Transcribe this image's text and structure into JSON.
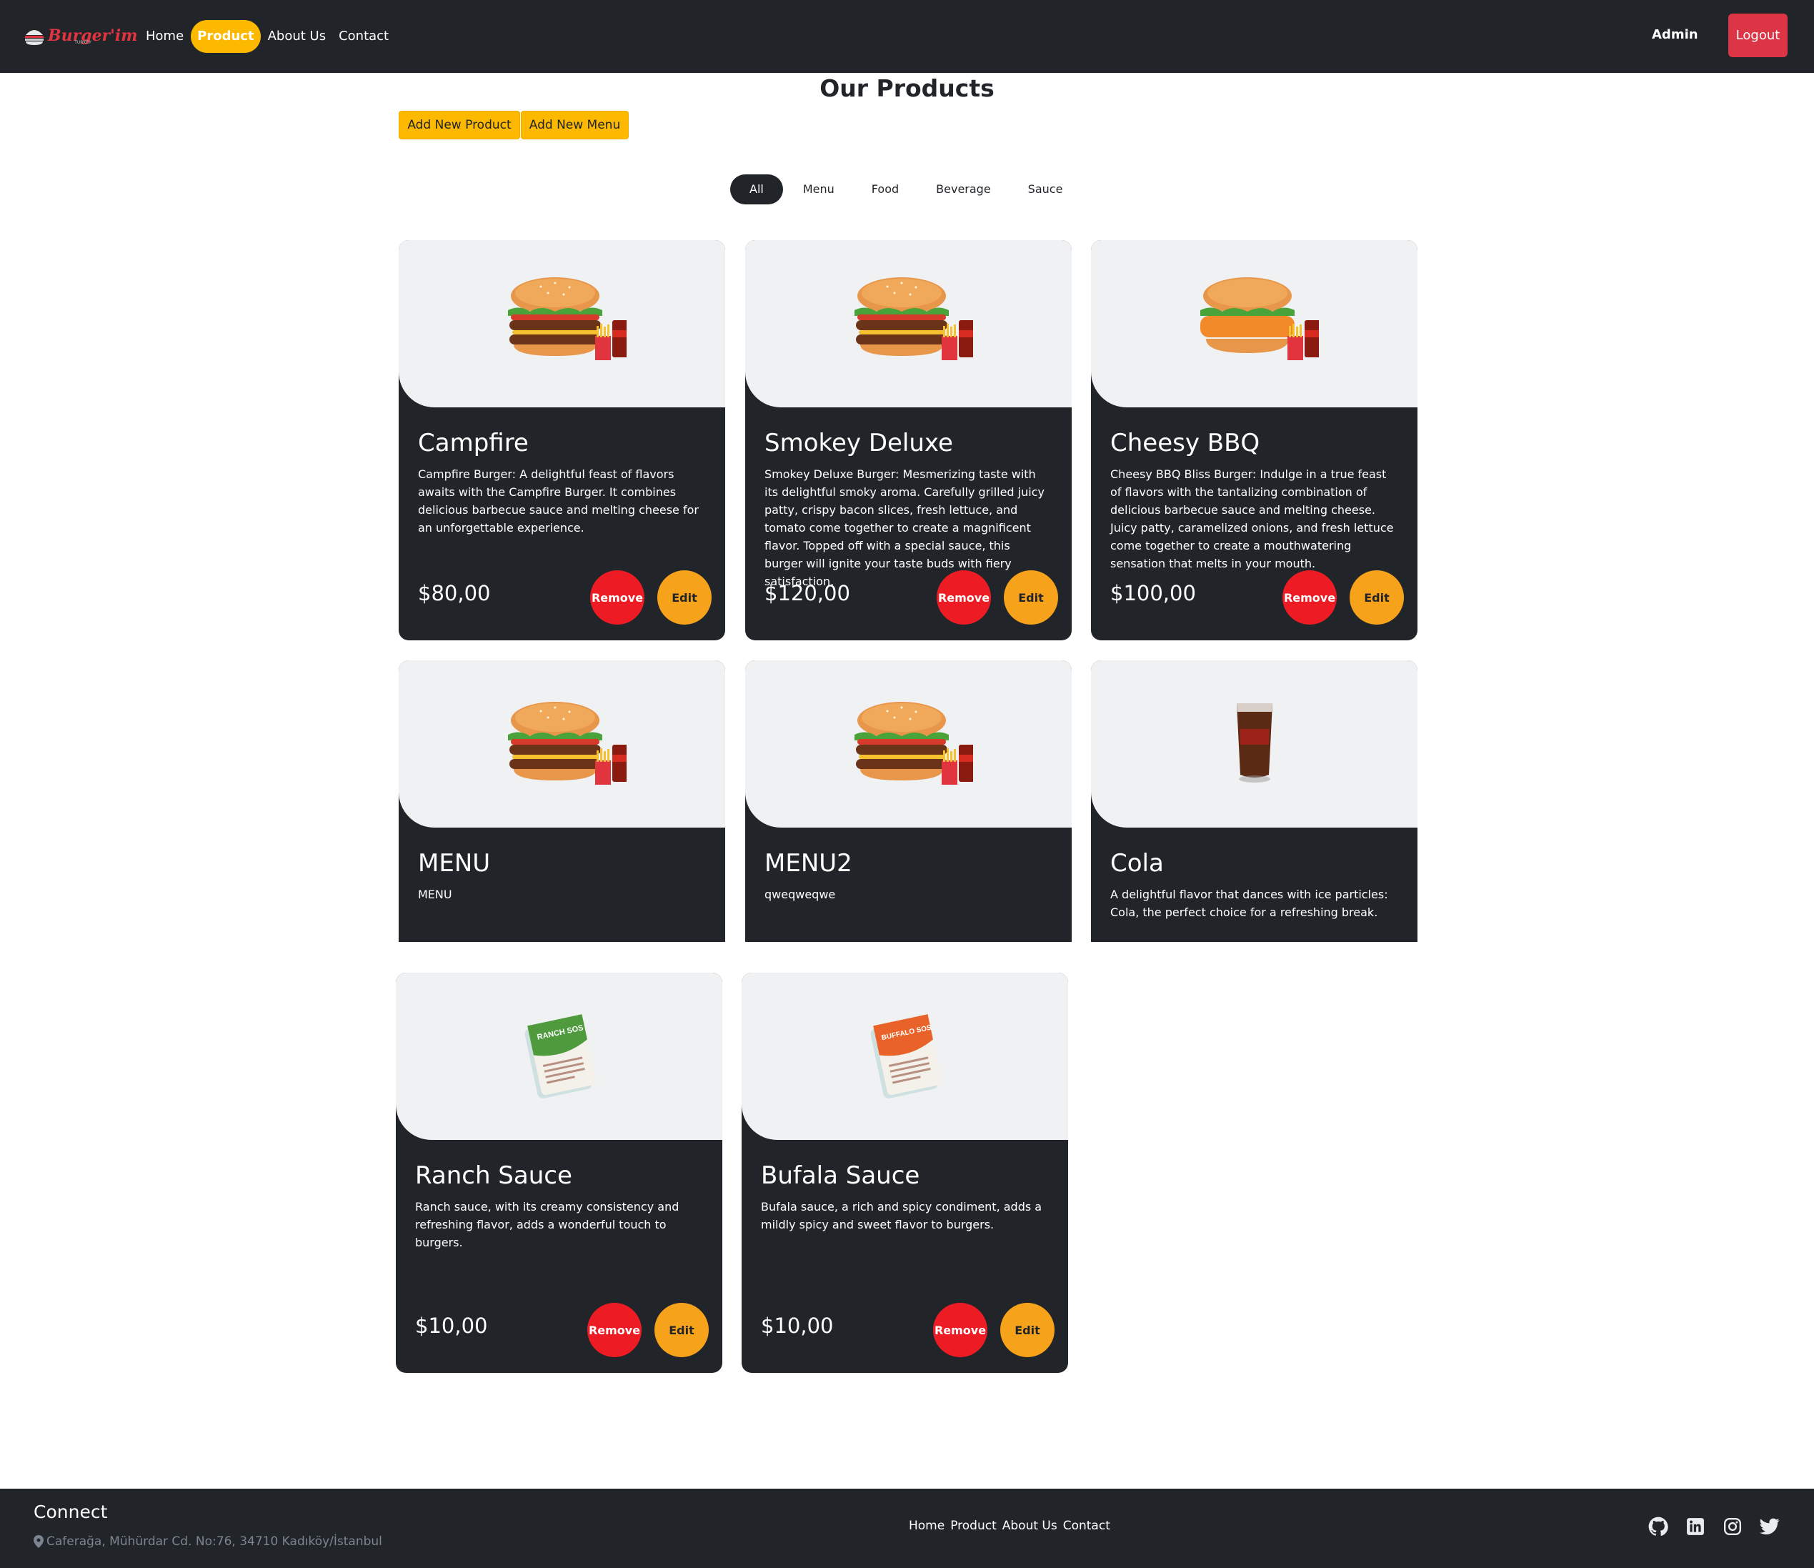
{
  "navbar": {
    "brand": "Burger'im",
    "brand_sub": "TURKEY",
    "links": [
      "Home",
      "Product",
      "About Us",
      "Contact"
    ],
    "active_link": "Product",
    "admin_label": "Admin",
    "logout_label": "Logout",
    "colors": {
      "bg": "#212529",
      "active": "#fcb900",
      "logout": "#dc3545"
    }
  },
  "main": {
    "title": "Our Products",
    "add_product_label": "Add New Product",
    "add_menu_label": "Add New Menu",
    "filters": [
      "All",
      "Menu",
      "Food",
      "Beverage",
      "Sauce"
    ],
    "active_filter": "All"
  },
  "products": [
    {
      "name": "Campfire",
      "description": "Campfire Burger: A delightful feast of flavors awaits with the Campfire Burger. It combines delicious barbecue sauce and melting cheese for an unforgettable experience.",
      "price": "$80,00",
      "image": "burger-menu-image",
      "remove_label": "Remove",
      "edit_label": "Edit"
    },
    {
      "name": "Smokey Deluxe",
      "description": "Smokey Deluxe Burger: Mesmerizing taste with its delightful smoky aroma. Carefully grilled juicy patty, crispy bacon slices, fresh lettuce, and tomato come together to create a magnificent flavor. Topped off with a special sauce, this burger will ignite your taste buds with fiery satisfaction.",
      "price": "$120,00",
      "image": "burger-menu-image",
      "remove_label": "Remove",
      "edit_label": "Edit"
    },
    {
      "name": "Cheesy BBQ",
      "description": "Cheesy BBQ Bliss Burger: Indulge in a true feast of flavors with the tantalizing combination of delicious barbecue sauce and melting cheese. Juicy patty, caramelized onions, and fresh lettuce come together to create a mouthwatering sensation that melts in your mouth.",
      "price": "$100,00",
      "image": "chicken-burger-menu-image",
      "remove_label": "Remove",
      "edit_label": "Edit"
    },
    {
      "name": "MENU",
      "description": "MENU",
      "image": "burger-menu-image"
    },
    {
      "name": "MENU2",
      "description": "qweqweqwe",
      "image": "burger-menu-image"
    },
    {
      "name": "Cola",
      "description": "A delightful flavor that dances with ice particles: Cola, the perfect choice for a refreshing break.",
      "image": "cola-glass-image"
    },
    {
      "name": "Ranch Sauce",
      "description": "Ranch sauce, with its creamy consistency and refreshing flavor, adds a wonderful touch to burgers.",
      "price": "$10,00",
      "image": "ranch-sauce-image",
      "pack_label": "RANCH SOS",
      "remove_label": "Remove",
      "edit_label": "Edit"
    },
    {
      "name": "Bufala Sauce",
      "description": "Bufala sauce, a rich and spicy condiment, adds a mildly spicy and sweet flavor to burgers.",
      "price": "$10,00",
      "image": "bufala-sauce-image",
      "pack_label": "BUFFALO SOS",
      "remove_label": "Remove",
      "edit_label": "Edit"
    }
  ],
  "footer": {
    "title": "Connect",
    "address": "Caferağa, Mühürdar Cd. No:76, 34710 Kadıköy/İstanbul",
    "links": [
      "Home",
      "Product",
      "About Us",
      "Contact"
    ],
    "socials": [
      "github-icon",
      "linkedin-icon",
      "instagram-icon",
      "twitter-icon"
    ]
  }
}
